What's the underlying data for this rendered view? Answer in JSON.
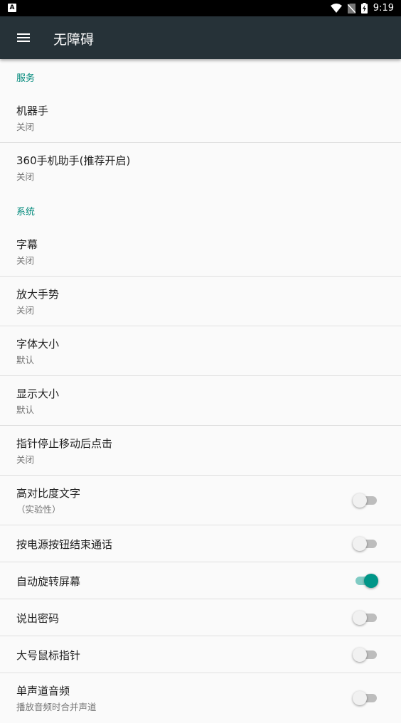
{
  "status_bar": {
    "notification_icon": "A",
    "time": "9:19",
    "icons": [
      "wifi-icon",
      "no-sim-icon",
      "battery-charging-icon"
    ]
  },
  "app_bar": {
    "menu_icon": "hamburger-menu-icon",
    "title": "无障碍"
  },
  "sections": {
    "services": {
      "header": "服务",
      "items": [
        {
          "title": "机器手",
          "summary": "关闭"
        },
        {
          "title": "360手机助手(推荐开启)",
          "summary": "关闭"
        }
      ]
    },
    "system": {
      "header": "系统",
      "items": [
        {
          "title": "字幕",
          "summary": "关闭"
        },
        {
          "title": "放大手势",
          "summary": "关闭"
        },
        {
          "title": "字体大小",
          "summary": "默认"
        },
        {
          "title": "显示大小",
          "summary": "默认"
        },
        {
          "title": "指针停止移动后点击",
          "summary": "关闭"
        },
        {
          "title": "高对比度文字",
          "summary": "（实验性）",
          "checked": false
        },
        {
          "title": "按电源按钮结束通话",
          "checked": false
        },
        {
          "title": "自动旋转屏幕",
          "checked": true
        },
        {
          "title": "说出密码",
          "checked": false
        },
        {
          "title": "大号鼠标指针",
          "checked": false
        },
        {
          "title": "单声道音频",
          "summary": "播放音频时合并声道",
          "checked": false
        }
      ]
    }
  },
  "colors": {
    "status_bar": "#000000",
    "app_bar": "#263238",
    "accent": "#00897b",
    "switch_on": "#009688"
  }
}
